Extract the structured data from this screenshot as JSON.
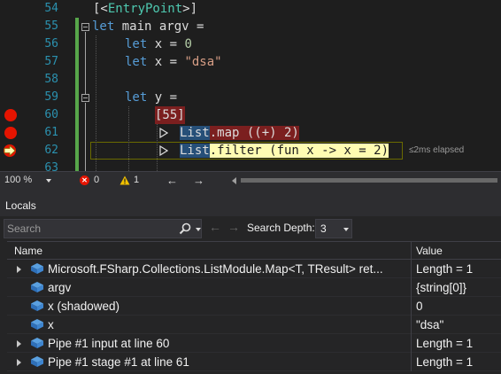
{
  "editor": {
    "lines": [
      {
        "number": "54",
        "parts": [
          {
            "t": "[<",
            "c": "plain"
          },
          {
            "t": "EntryPoint",
            "c": "attr"
          },
          {
            "t": ">]",
            "c": "plain"
          }
        ]
      },
      {
        "number": "55",
        "parts": [
          {
            "t": "let",
            "c": "kw"
          },
          {
            "t": " main argv =",
            "c": "plain"
          }
        ]
      },
      {
        "number": "56",
        "parts": [
          {
            "t": "let",
            "c": "kw"
          },
          {
            "t": " x = ",
            "c": "plain"
          },
          {
            "t": "0",
            "c": "num"
          }
        ]
      },
      {
        "number": "57",
        "parts": [
          {
            "t": "let",
            "c": "kw"
          },
          {
            "t": " x = ",
            "c": "plain"
          },
          {
            "t": "\"dsa\"",
            "c": "str"
          }
        ]
      },
      {
        "number": "58",
        "parts": []
      },
      {
        "number": "59",
        "parts": [
          {
            "t": "let",
            "c": "kw"
          },
          {
            "t": " y =",
            "c": "plain"
          }
        ]
      },
      {
        "number": "60",
        "parts": [
          {
            "t": "[55]",
            "c": "plain"
          }
        ]
      },
      {
        "number": "61",
        "parts": [
          {
            "t": "List",
            "c": "plain"
          },
          {
            "t": ".map ((+) 2)",
            "c": "plain"
          }
        ]
      },
      {
        "number": "62",
        "parts": [
          {
            "t": "List",
            "c": "plain"
          },
          {
            "t": ".filter (fun x -> x = 2)",
            "c": "plain"
          }
        ]
      },
      {
        "number": "63",
        "parts": []
      }
    ],
    "elapsed_label": "≤2ms elapsed"
  },
  "status_strip": {
    "zoom": "100 %",
    "error_count": "0",
    "warning_count": "1",
    "back_arrow": "←",
    "forward_arrow": "→"
  },
  "locals": {
    "title": "Locals",
    "search_placeholder": "Search",
    "search_depth_label": "Search Depth:",
    "search_depth_value": "3",
    "columns": {
      "name": "Name",
      "value": "Value"
    },
    "rows": [
      {
        "name": "Microsoft.FSharp.Collections.ListModule.Map<T, TResult> ret...",
        "value": "Length = 1",
        "expandable": true
      },
      {
        "name": "argv",
        "value": "{string[0]}",
        "expandable": false
      },
      {
        "name": "x (shadowed)",
        "value": "0",
        "expandable": false
      },
      {
        "name": "x",
        "value": "\"dsa\"",
        "expandable": false
      },
      {
        "name": "Pipe #1 input at line 60",
        "value": "Length = 1",
        "expandable": true
      },
      {
        "name": "Pipe #1 stage #1 at line 61",
        "value": "Length = 1",
        "expandable": true
      }
    ]
  },
  "colors": {
    "breakpoint": "#e51400",
    "current_line": "#fffcb2",
    "change_bar": "#57a64a",
    "keyword": "#569cd6",
    "string": "#d69d85",
    "number": "#b5cea8",
    "line_number": "#2b91af"
  }
}
